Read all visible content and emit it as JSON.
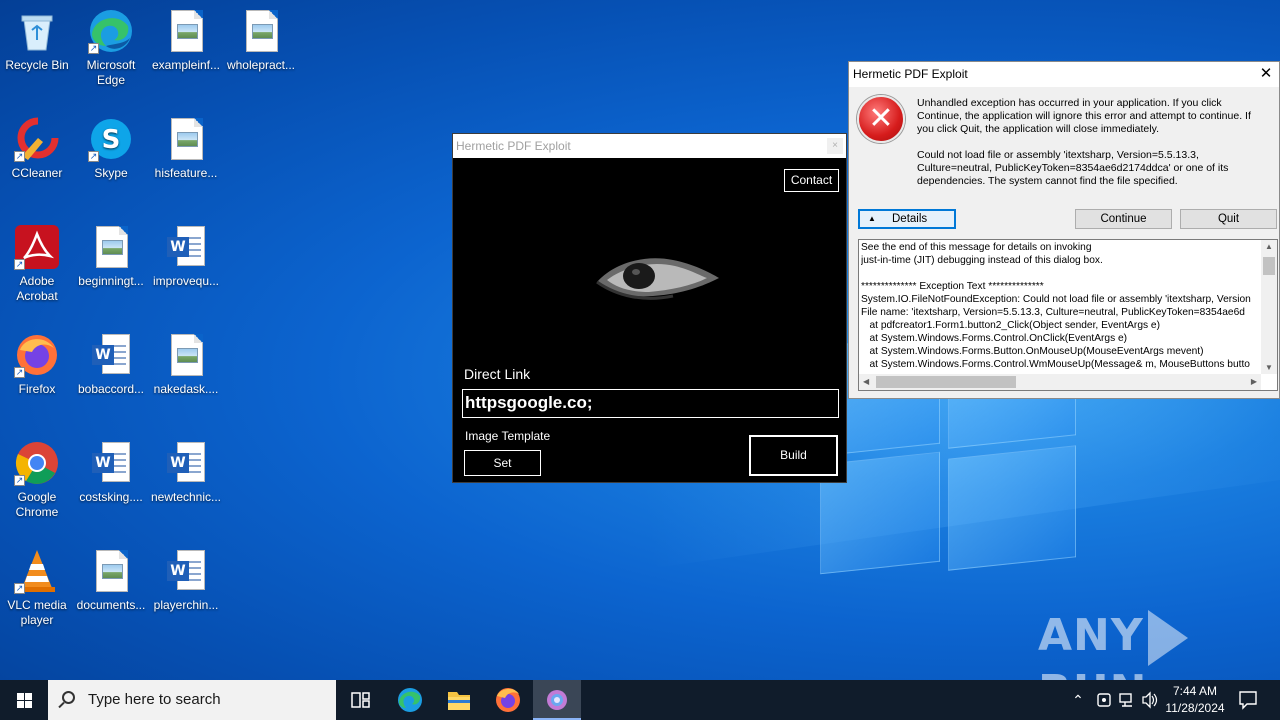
{
  "desktop": {
    "icons": [
      {
        "label": "Recycle Bin",
        "icon": "recycle-bin-icon"
      },
      {
        "label": "Microsoft Edge",
        "icon": "edge-icon"
      },
      {
        "label": "exampleinf...",
        "icon": "image-file-icon"
      },
      {
        "label": "wholepract...",
        "icon": "image-file-icon"
      },
      {
        "label": "CCleaner",
        "icon": "ccleaner-icon"
      },
      {
        "label": "Skype",
        "icon": "skype-icon"
      },
      {
        "label": "hisfeature...",
        "icon": "image-file-icon"
      },
      {
        "label": "Adobe Acrobat",
        "icon": "acrobat-icon"
      },
      {
        "label": "beginningt...",
        "icon": "image-file-icon"
      },
      {
        "label": "improvequ...",
        "icon": "word-file-icon"
      },
      {
        "label": "Firefox",
        "icon": "firefox-icon"
      },
      {
        "label": "bobaccord...",
        "icon": "word-file-icon"
      },
      {
        "label": "nakedask....",
        "icon": "image-file-icon"
      },
      {
        "label": "Google Chrome",
        "icon": "chrome-icon"
      },
      {
        "label": "costsking....",
        "icon": "word-file-icon"
      },
      {
        "label": "newtechnic...",
        "icon": "word-file-icon"
      },
      {
        "label": "VLC media player",
        "icon": "vlc-icon"
      },
      {
        "label": "documents...",
        "icon": "image-file-icon"
      },
      {
        "label": "playerchin...",
        "icon": "word-file-icon"
      }
    ]
  },
  "app_window": {
    "title": "Hermetic PDF Exploit",
    "close_glyph": "×",
    "contact_label": "Contact",
    "direct_link_label": "Direct Link",
    "direct_link_value": "httpsgoogle.co;",
    "image_template_label": "Image Template",
    "set_label": "Set",
    "build_label": "Build"
  },
  "error_dialog": {
    "title": "Hermetic PDF Exploit",
    "close_glyph": "✕",
    "icon": "error-x-icon",
    "message_1": "Unhandled exception has occurred in your application. If you click Continue, the application will ignore this error and attempt to continue. If you click Quit, the application will close immediately.",
    "message_2": "Could not load file or assembly 'itextsharp, Version=5.5.13.3, Culture=neutral, PublicKeyToken=8354ae6d2174ddca' or one of its dependencies. The system cannot find the file specified.",
    "details_label": "Details",
    "continue_label": "Continue",
    "quit_label": "Quit",
    "details_text": "See the end of this message for details on invoking\njust-in-time (JIT) debugging instead of this dialog box.\n\n************** Exception Text **************\nSystem.IO.FileNotFoundException: Could not load file or assembly 'itextsharp, Version\nFile name: 'itextsharp, Version=5.5.13.3, Culture=neutral, PublicKeyToken=8354ae6d\n   at pdfcreator1.Form1.button2_Click(Object sender, EventArgs e)\n   at System.Windows.Forms.Control.OnClick(EventArgs e)\n   at System.Windows.Forms.Button.OnMouseUp(MouseEventArgs mevent)\n   at System.Windows.Forms.Control.WmMouseUp(Message& m, MouseButtons butto"
  },
  "watermark": {
    "left": "ANY",
    "right": "RUN"
  },
  "taskbar": {
    "search_placeholder": "Type here to search",
    "pinned": [
      "task-view-icon",
      "edge-icon",
      "file-explorer-icon",
      "firefox-icon",
      "hermetic-app-icon"
    ],
    "time": "7:44 AM",
    "date": "11/28/2024"
  }
}
